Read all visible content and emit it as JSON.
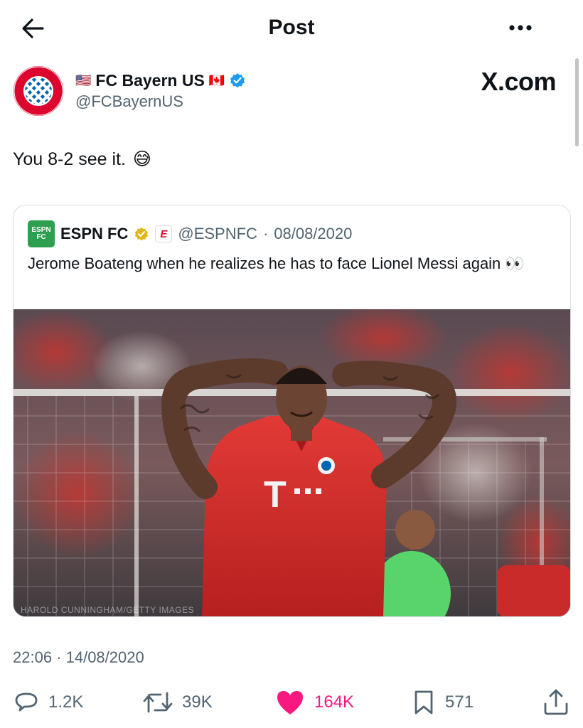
{
  "header": {
    "title": "Post"
  },
  "author": {
    "name": "FC Bayern US",
    "handle": "@FCBayernUS",
    "flag_left": "🇺🇸",
    "flag_right": "🇨🇦",
    "verified": true
  },
  "watermark_brand": "X.com",
  "tweet": {
    "text": "You 8-2 see it.",
    "emoji": "😅"
  },
  "quoted": {
    "name": "ESPN FC",
    "handle": "@ESPNFC",
    "date": "08/08/2020",
    "separator": "·",
    "text": "Jerome Boateng when he realizes he has to face Lionel Messi again",
    "emoji": "👀",
    "logo_lines": [
      "ESPN",
      "FC"
    ],
    "badge_letter": "E",
    "photo_credit": "HAROLD CUNNINGHAM/GETTY IMAGES"
  },
  "timestamp": "22:06 · 14/08/2020",
  "actions": {
    "replies": "1.2K",
    "reposts": "39K",
    "likes": "164K",
    "bookmarks": "571"
  },
  "colors": {
    "like": "#f91880",
    "verified_blue": "#1d9bf0",
    "verified_gold": "#e2b719",
    "espn_green": "#2e9e4f",
    "bayern_red": "#dc052d",
    "bayern_blue": "#0066b2"
  },
  "icons": [
    "back-arrow-icon",
    "more-icon",
    "verified-badge-icon",
    "reply-icon",
    "repost-icon",
    "like-icon",
    "bookmark-icon",
    "share-icon"
  ]
}
